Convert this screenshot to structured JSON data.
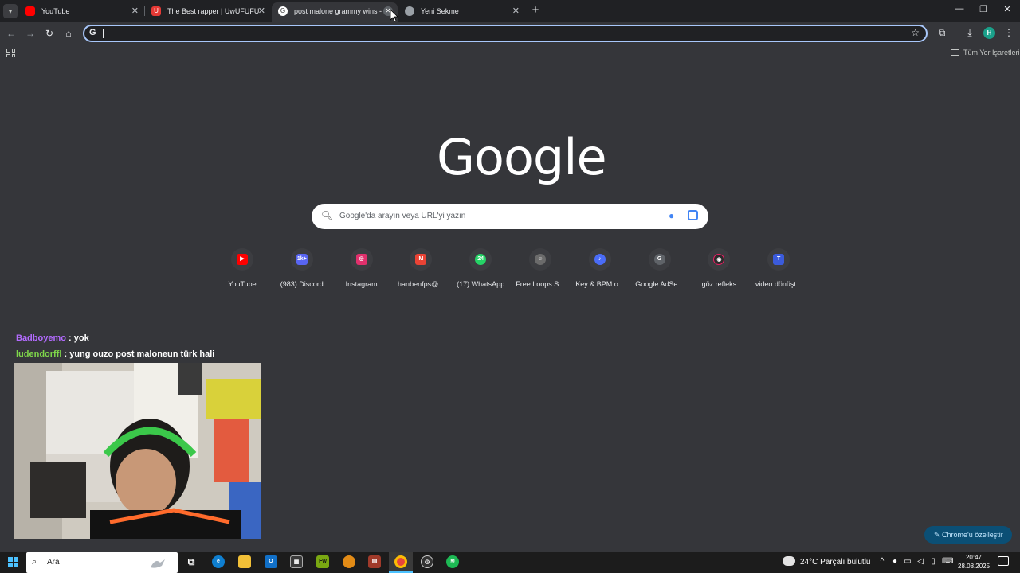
{
  "tabs": [
    {
      "title": "YouTube",
      "favicon": "youtube-icon",
      "color": "#ff0000"
    },
    {
      "title": "The Best rapper | UwUFUFU",
      "favicon": "uwufufu-icon",
      "color": "#e53935"
    },
    {
      "title": "post malone grammy wins - Go",
      "favicon": "google-icon",
      "color": "#ffffff",
      "active": true
    },
    {
      "title": "Yeni Sekme",
      "favicon": "chrome-icon",
      "color": "#9aa0a6"
    }
  ],
  "omnibox": {
    "value": "",
    "g": "G"
  },
  "profile_initial": "H",
  "bookmarks": {
    "all_label": "Tüm Yer İşaretleri"
  },
  "logo_text": "Google",
  "search": {
    "placeholder": "Google'da arayın veya URL'yi yazın"
  },
  "shortcuts": [
    {
      "label": "YouTube",
      "icon": "youtube-icon",
      "color": "#ff0000",
      "glyph": "▶"
    },
    {
      "label": "(983) Discord",
      "icon": "discord-icon",
      "color": "#5865f2",
      "glyph": "1k+"
    },
    {
      "label": "Instagram",
      "icon": "instagram-icon",
      "color": "#e1306c",
      "glyph": "◎"
    },
    {
      "label": "hanbenfps@...",
      "icon": "gmail-icon",
      "color": "#ea4335",
      "glyph": "M"
    },
    {
      "label": "(17) WhatsApp",
      "icon": "whatsapp-icon",
      "color": "#25d366",
      "glyph": "24"
    },
    {
      "label": "Free Loops S...",
      "icon": "freeloops-icon",
      "color": "#6b6b6b",
      "glyph": "☺"
    },
    {
      "label": "Key & BPM o...",
      "icon": "key-bpm-icon",
      "color": "#4a6cf7",
      "glyph": "♪"
    },
    {
      "label": "Google AdSe...",
      "icon": "adsense-icon",
      "color": "#5f6368",
      "glyph": "G"
    },
    {
      "label": "göz refleks",
      "icon": "reflex-icon",
      "color": "#2b2b2b",
      "glyph": "◉"
    },
    {
      "label": "video dönüşt...",
      "icon": "video-converter-icon",
      "color": "#3b5bdb",
      "glyph": "T"
    }
  ],
  "chat": [
    {
      "user": "Badboyemo",
      "color": "#b36bff",
      "message": " : yok"
    },
    {
      "user": "ludendorffl",
      "color": "#7fd74a",
      "message": " : yung ouzo post maloneun türk hali"
    }
  ],
  "customize_label": "Chrome'u özelleştir",
  "taskbar": {
    "search_label": "Ara",
    "weather": "24°C  Parçalı bulutlu",
    "time": "20:47",
    "date": "28.08.2025"
  }
}
